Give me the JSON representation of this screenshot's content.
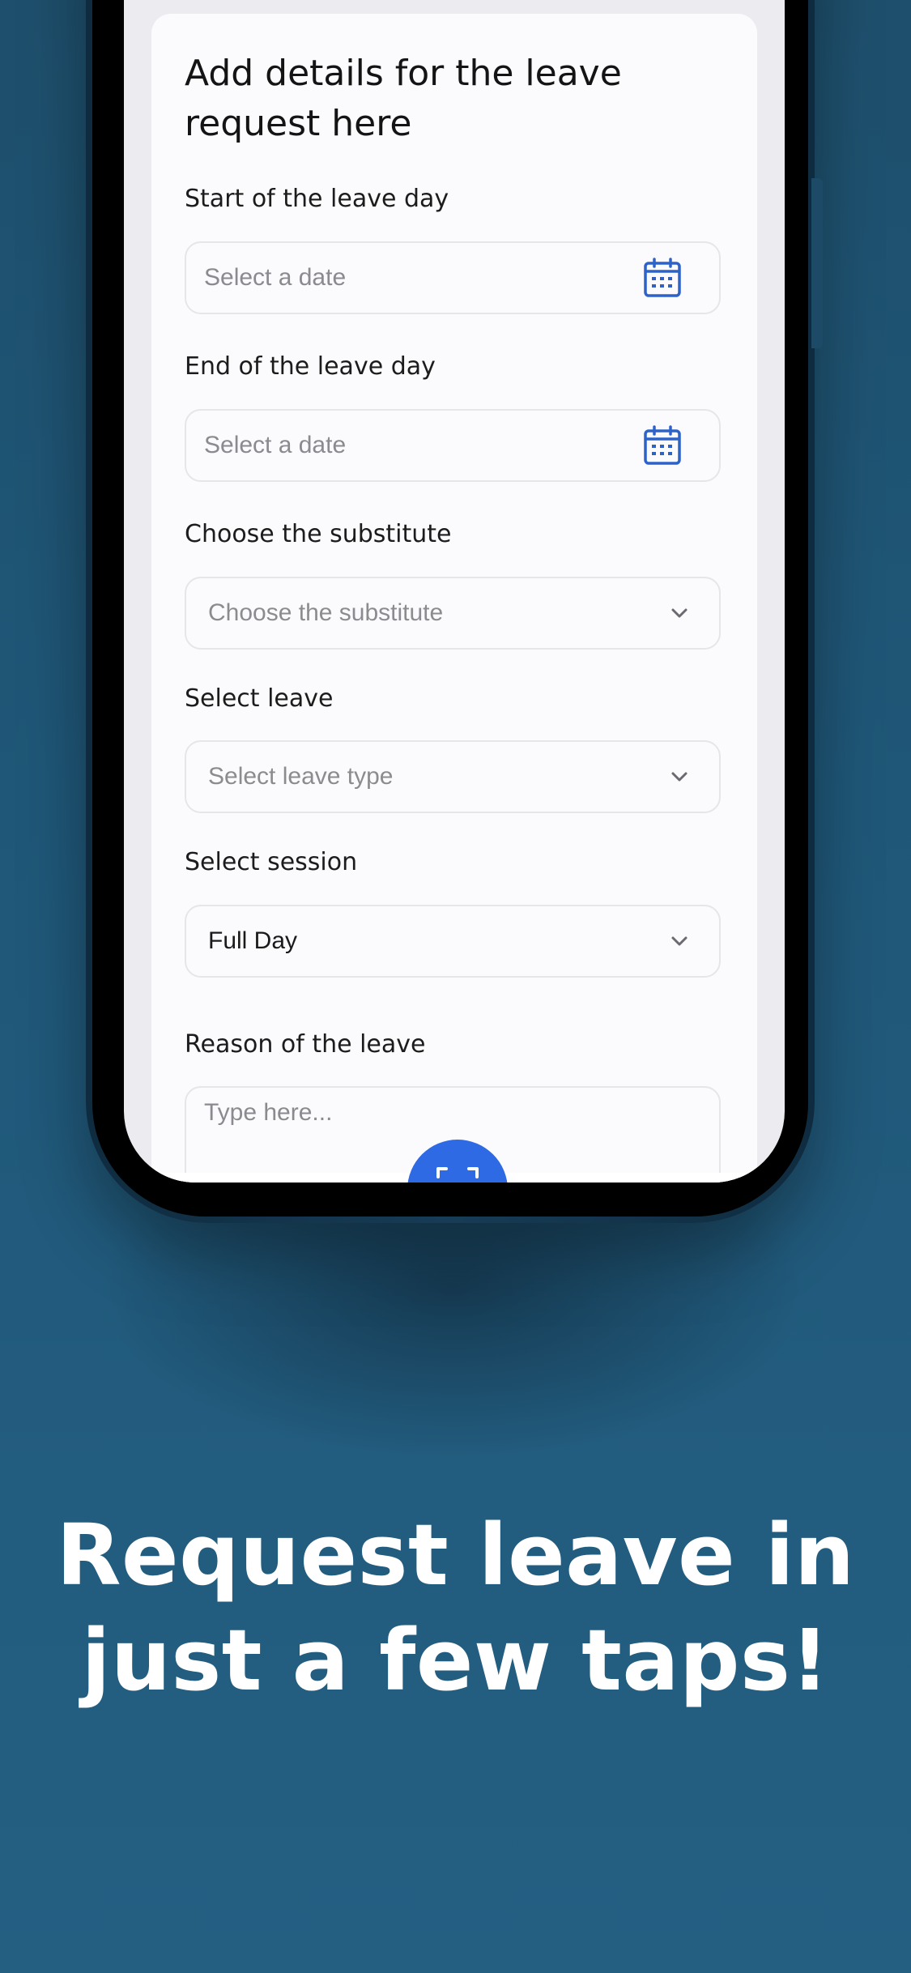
{
  "form": {
    "title": "Add details for the leave request here",
    "start_label": "Start of the leave day",
    "start_placeholder": "Select a date",
    "end_label": "End of the leave day",
    "end_placeholder": "Select a date",
    "substitute_label": "Choose the substitute",
    "substitute_placeholder": "Choose the substitute",
    "leave_label": "Select leave",
    "leave_placeholder": "Select leave type",
    "session_label": "Select session",
    "session_value": "Full Day",
    "reason_label": "Reason of the leave",
    "reason_placeholder": "Type here..."
  },
  "icons": {
    "calendar": "calendar-icon",
    "chevron": "chevron-down-icon",
    "scan": "scan-icon"
  },
  "colors": {
    "accent": "#2f6ae5",
    "background": "#1f5778",
    "icon_blue": "#2d63c8"
  },
  "promo": {
    "line1": "Request leave in",
    "line2": "just a few taps!"
  }
}
